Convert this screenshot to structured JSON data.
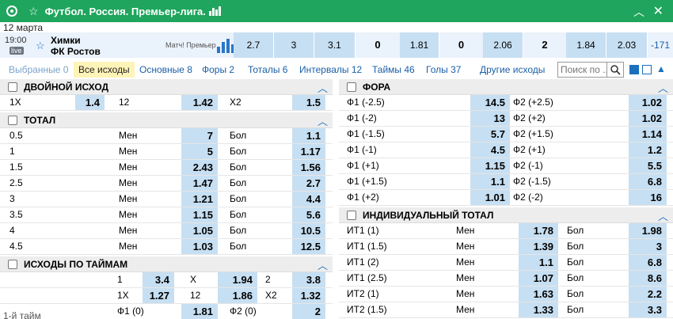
{
  "header": {
    "title": "Футбол. Россия. Премьер-лига."
  },
  "date": "12 марта",
  "match": {
    "time": "19:00",
    "live_label": "live",
    "team1": "Химки",
    "team2": "ФК Ростов",
    "league": "Матч! Премьер",
    "cells": [
      "2.7",
      "3",
      "3.1",
      "0",
      "1.81",
      "0",
      "2.06",
      "2",
      "1.84",
      "2.03",
      "-171"
    ]
  },
  "tabs": [
    "Выбранные 0",
    "Все исходы",
    "Основные 8",
    "Форы 2",
    "Тоталы 6",
    "Интервалы 12",
    "Таймы 46",
    "Голы 37",
    "Другие исходы"
  ],
  "search": {
    "placeholder": "Поиск по ..."
  },
  "double": {
    "title": "ДВОЙНОЙ ИСХОД",
    "row": [
      "1X",
      "1.4",
      "12",
      "1.42",
      "X2",
      "1.5"
    ]
  },
  "total": {
    "title": "ТОТАЛ",
    "rows": [
      [
        "0.5",
        "Мен",
        "7",
        "Бол",
        "1.1"
      ],
      [
        "1",
        "Мен",
        "5",
        "Бол",
        "1.17"
      ],
      [
        "1.5",
        "Мен",
        "2.43",
        "Бол",
        "1.56"
      ],
      [
        "2.5",
        "Мен",
        "1.47",
        "Бол",
        "2.7"
      ],
      [
        "3",
        "Мен",
        "1.21",
        "Бол",
        "4.4"
      ],
      [
        "3.5",
        "Мен",
        "1.15",
        "Бол",
        "5.6"
      ],
      [
        "4",
        "Мен",
        "1.05",
        "Бол",
        "10.5"
      ],
      [
        "4.5",
        "Мен",
        "1.03",
        "Бол",
        "12.5"
      ]
    ]
  },
  "halves": {
    "title": "ИСХОДЫ ПО ТАЙМАМ",
    "rows": [
      [
        "1",
        "3.4",
        "X",
        "1.94",
        "2",
        "3.8"
      ],
      [
        "1X",
        "1.27",
        "12",
        "1.86",
        "X2",
        "1.32"
      ],
      [
        "Ф1 (0)",
        "1.81",
        "Ф2 (0)",
        "2"
      ]
    ],
    "first_half_label": "1-й тайм"
  },
  "fora": {
    "title": "ФОРА",
    "rows": [
      [
        "Ф1 (-2.5)",
        "14.5",
        "Ф2 (+2.5)",
        "1.02"
      ],
      [
        "Ф1 (-2)",
        "13",
        "Ф2 (+2)",
        "1.02"
      ],
      [
        "Ф1 (-1.5)",
        "5.7",
        "Ф2 (+1.5)",
        "1.14"
      ],
      [
        "Ф1 (-1)",
        "4.5",
        "Ф2 (+1)",
        "1.2"
      ],
      [
        "Ф1 (+1)",
        "1.15",
        "Ф2 (-1)",
        "5.5"
      ],
      [
        "Ф1 (+1.5)",
        "1.1",
        "Ф2 (-1.5)",
        "6.8"
      ],
      [
        "Ф1 (+2)",
        "1.01",
        "Ф2 (-2)",
        "16"
      ]
    ]
  },
  "indiv": {
    "title": "ИНДИВИДУАЛЬНЫЙ ТОТАЛ",
    "rows": [
      [
        "ИТ1 (1)",
        "Мен",
        "1.78",
        "Бол",
        "1.98"
      ],
      [
        "ИТ1 (1.5)",
        "Мен",
        "1.39",
        "Бол",
        "3"
      ],
      [
        "ИТ1 (2)",
        "Мен",
        "1.1",
        "Бол",
        "6.8"
      ],
      [
        "ИТ1 (2.5)",
        "Мен",
        "1.07",
        "Бол",
        "8.6"
      ],
      [
        "ИТ2 (1)",
        "Мен",
        "1.63",
        "Бол",
        "2.2"
      ],
      [
        "ИТ2 (1.5)",
        "Мен",
        "1.33",
        "Бол",
        "3.3"
      ]
    ]
  }
}
